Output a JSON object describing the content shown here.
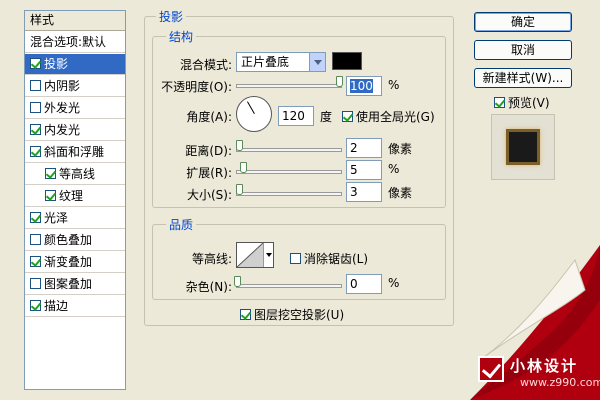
{
  "left_panel": {
    "header": "样式",
    "items": [
      {
        "label": "混合选项:默认",
        "checkbox": false,
        "checked": false,
        "selected": false,
        "indent": false
      },
      {
        "label": "投影",
        "checkbox": true,
        "checked": true,
        "selected": true,
        "indent": false
      },
      {
        "label": "内阴影",
        "checkbox": true,
        "checked": false,
        "selected": false,
        "indent": false
      },
      {
        "label": "外发光",
        "checkbox": true,
        "checked": false,
        "selected": false,
        "indent": false
      },
      {
        "label": "内发光",
        "checkbox": true,
        "checked": true,
        "selected": false,
        "indent": false
      },
      {
        "label": "斜面和浮雕",
        "checkbox": true,
        "checked": true,
        "selected": false,
        "indent": false
      },
      {
        "label": "等高线",
        "checkbox": true,
        "checked": true,
        "selected": false,
        "indent": true
      },
      {
        "label": "纹理",
        "checkbox": true,
        "checked": true,
        "selected": false,
        "indent": true
      },
      {
        "label": "光泽",
        "checkbox": true,
        "checked": true,
        "selected": false,
        "indent": false
      },
      {
        "label": "颜色叠加",
        "checkbox": true,
        "checked": false,
        "selected": false,
        "indent": false
      },
      {
        "label": "渐变叠加",
        "checkbox": true,
        "checked": true,
        "selected": false,
        "indent": false
      },
      {
        "label": "图案叠加",
        "checkbox": true,
        "checked": false,
        "selected": false,
        "indent": false
      },
      {
        "label": "描边",
        "checkbox": true,
        "checked": true,
        "selected": false,
        "indent": false
      }
    ]
  },
  "drop_shadow": {
    "title": "投影",
    "structure": {
      "title": "结构",
      "blend_mode_label": "混合模式:",
      "blend_mode_value": "正片叠底",
      "shadow_color": "#000000",
      "opacity_label": "不透明度(O):",
      "opacity_value": "100",
      "opacity_unit": "%",
      "opacity_fraction": 1.0,
      "angle_label": "角度(A):",
      "angle_value": "120",
      "angle_unit": "度",
      "global_light_label": "使用全局光(G)",
      "global_light_checked": true,
      "distance_label": "距离(D):",
      "distance_value": "2",
      "distance_unit": "像素",
      "distance_fraction": 0.0,
      "spread_label": "扩展(R):",
      "spread_value": "5",
      "spread_unit": "%",
      "spread_fraction": 0.05,
      "size_label": "大小(S):",
      "size_value": "3",
      "size_unit": "像素",
      "size_fraction": 0.0
    },
    "quality": {
      "title": "品质",
      "contour_label": "等高线:",
      "anti_alias_label": "消除锯齿(L)",
      "anti_alias_checked": false,
      "noise_label": "杂色(N):",
      "noise_value": "0",
      "noise_unit": "%",
      "noise_fraction": 0.0
    },
    "knockout_label": "图层挖空投影(U)",
    "knockout_checked": true
  },
  "buttons": {
    "ok": "确定",
    "cancel": "取消",
    "new_style": "新建样式(W)...",
    "preview_label": "预览(V)",
    "preview_checked": true
  },
  "watermark": {
    "brand": "小林设计",
    "url": "www.z990.com",
    "color": "#b00010"
  }
}
